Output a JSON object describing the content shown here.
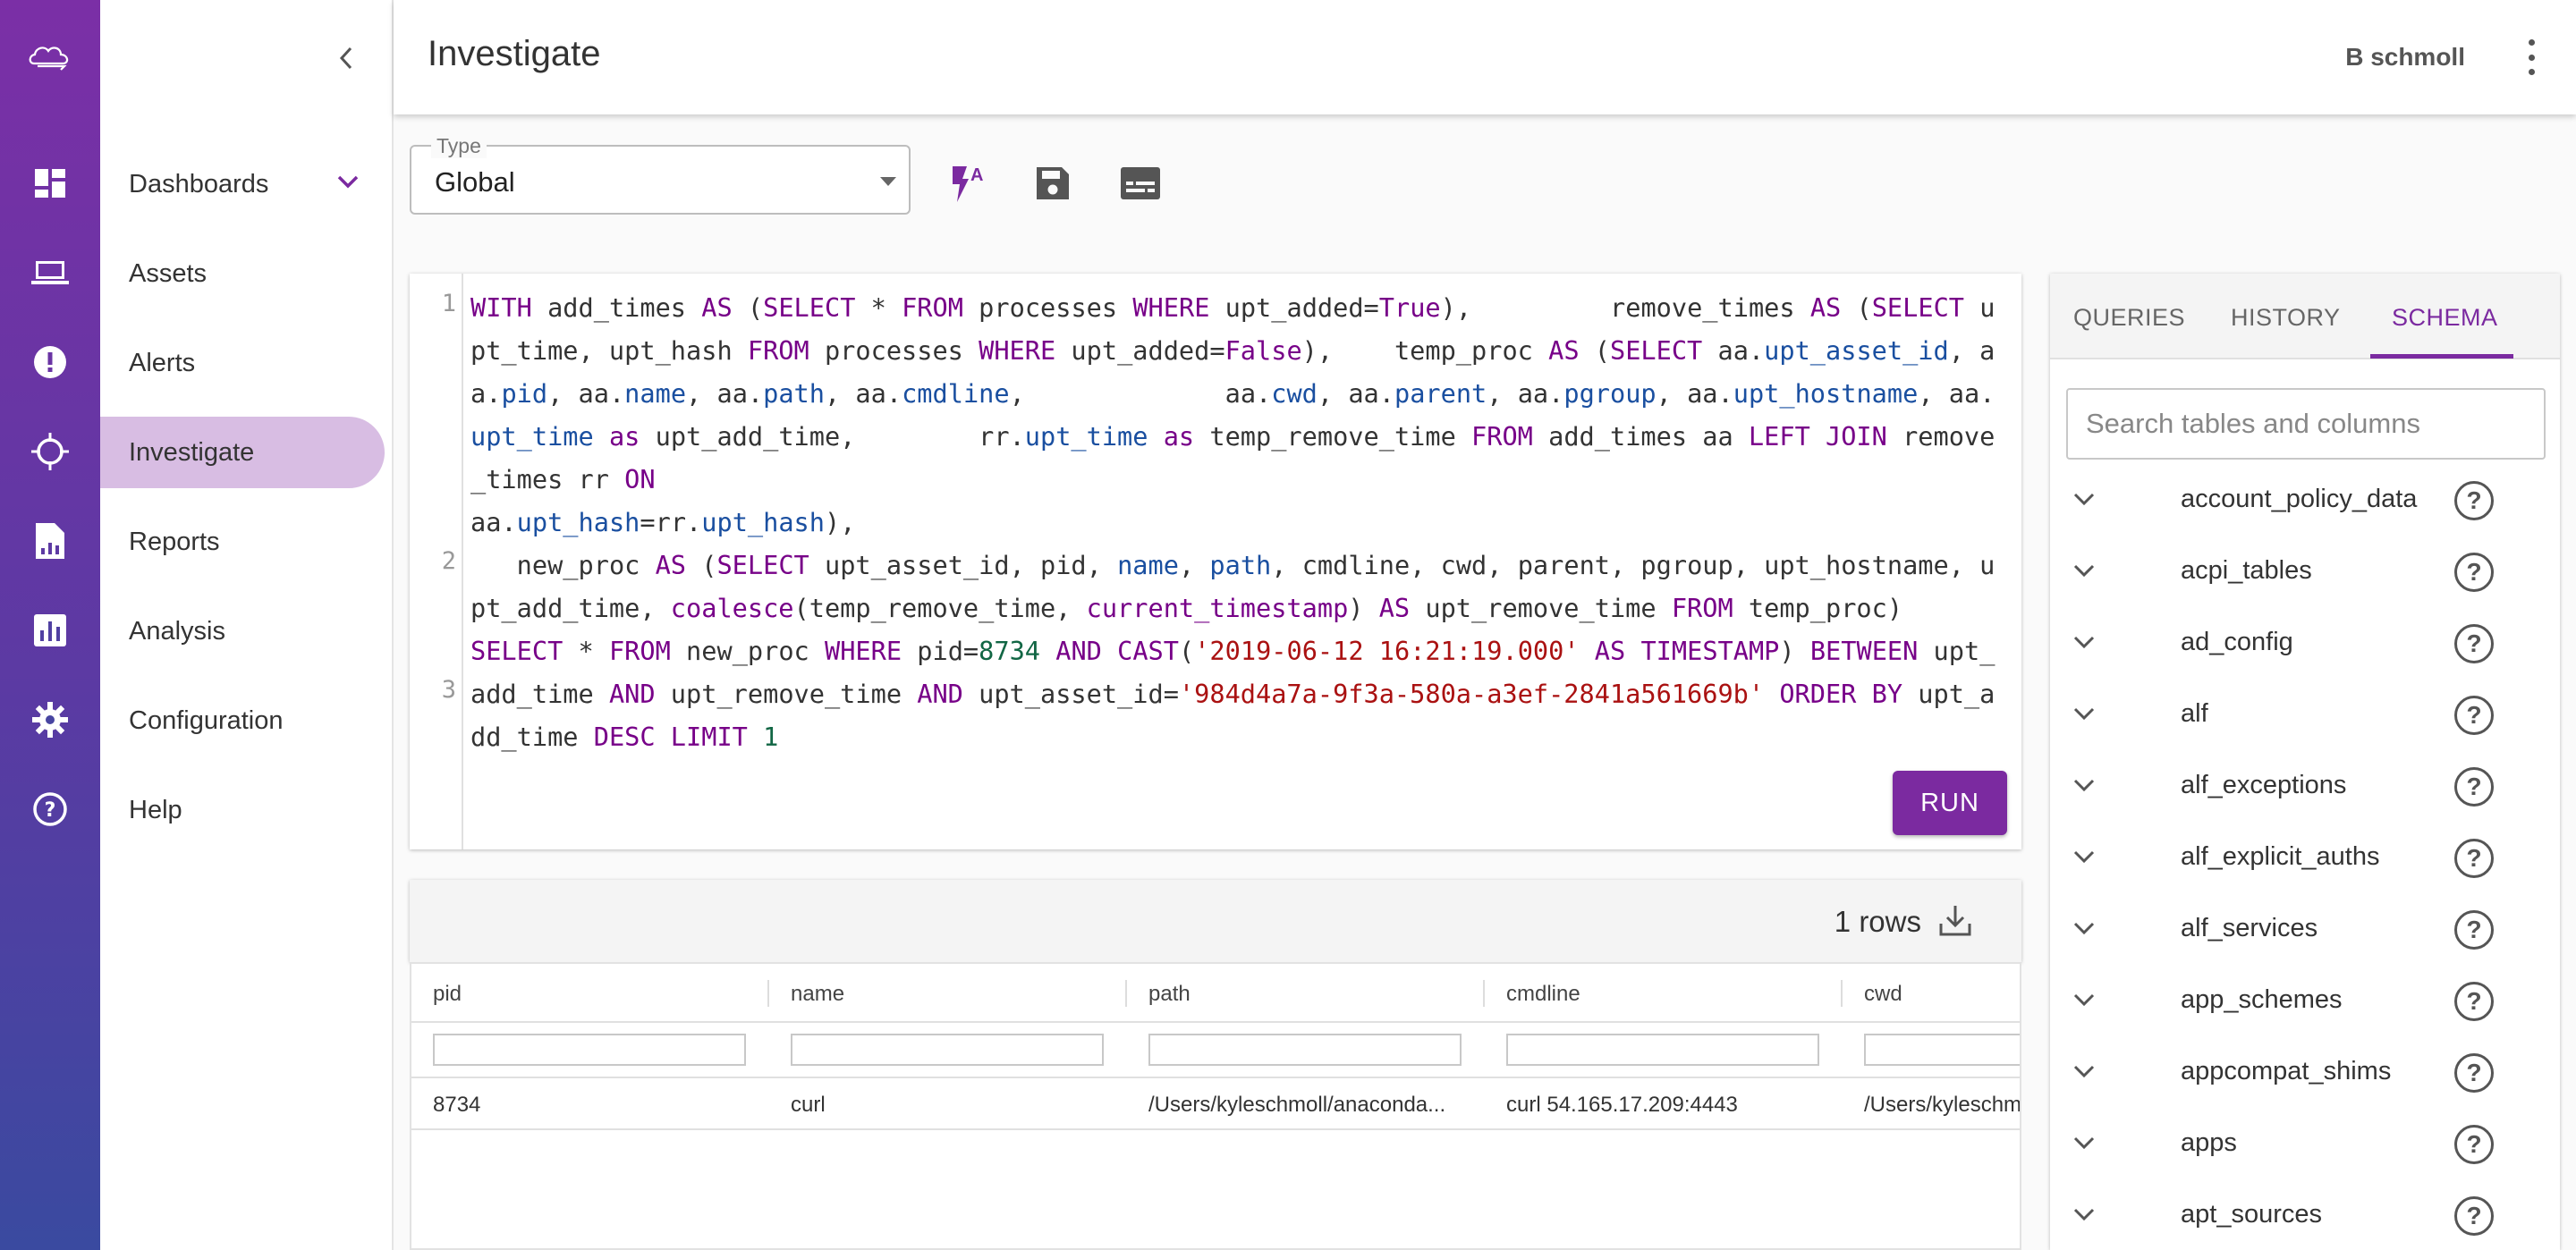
{
  "header": {
    "title": "Investigate",
    "user": "B schmoll"
  },
  "nav": {
    "items": [
      {
        "label": "Dashboards"
      },
      {
        "label": "Assets"
      },
      {
        "label": "Alerts"
      },
      {
        "label": "Investigate"
      },
      {
        "label": "Reports"
      },
      {
        "label": "Analysis"
      },
      {
        "label": "Configuration"
      },
      {
        "label": "Help"
      }
    ],
    "active": "Investigate"
  },
  "rail_icons": [
    "cloud-logo-icon",
    "dashboard-icon",
    "laptop-icon",
    "alert-icon",
    "crosshair-icon",
    "report-icon",
    "analysis-icon",
    "gear-icon",
    "help-icon"
  ],
  "type_select": {
    "legend": "Type",
    "value": "Global"
  },
  "toolbar": {
    "icons": [
      "format-icon",
      "save-icon",
      "subtitles-icon"
    ]
  },
  "editor": {
    "line_numbers": [
      "1",
      "2",
      "3"
    ],
    "run_label": "RUN"
  },
  "results": {
    "count": "1 rows",
    "columns": [
      "pid",
      "name",
      "path",
      "cmdline",
      "cwd"
    ],
    "rows": [
      [
        "8734",
        "curl",
        "/Users/kyleschmoll/anaconda...",
        "curl 54.165.17.209:4443",
        "/Users/kyleschmoll/"
      ]
    ]
  },
  "schema_panel": {
    "tabs": [
      "QUERIES",
      "HISTORY",
      "SCHEMA"
    ],
    "active_tab": "SCHEMA",
    "search_placeholder": "Search tables and columns",
    "tables": [
      "account_policy_data",
      "acpi_tables",
      "ad_config",
      "alf",
      "alf_exceptions",
      "alf_explicit_auths",
      "alf_services",
      "app_schemes",
      "appcompat_shims",
      "apps",
      "apt_sources"
    ],
    "help_glyph": "?"
  },
  "colors": {
    "accent": "#7b2aa0",
    "active_nav": "#d8bde3",
    "keyword": "#770088",
    "property": "#1a4fa0",
    "string": "#aa1111",
    "number": "#116644"
  }
}
